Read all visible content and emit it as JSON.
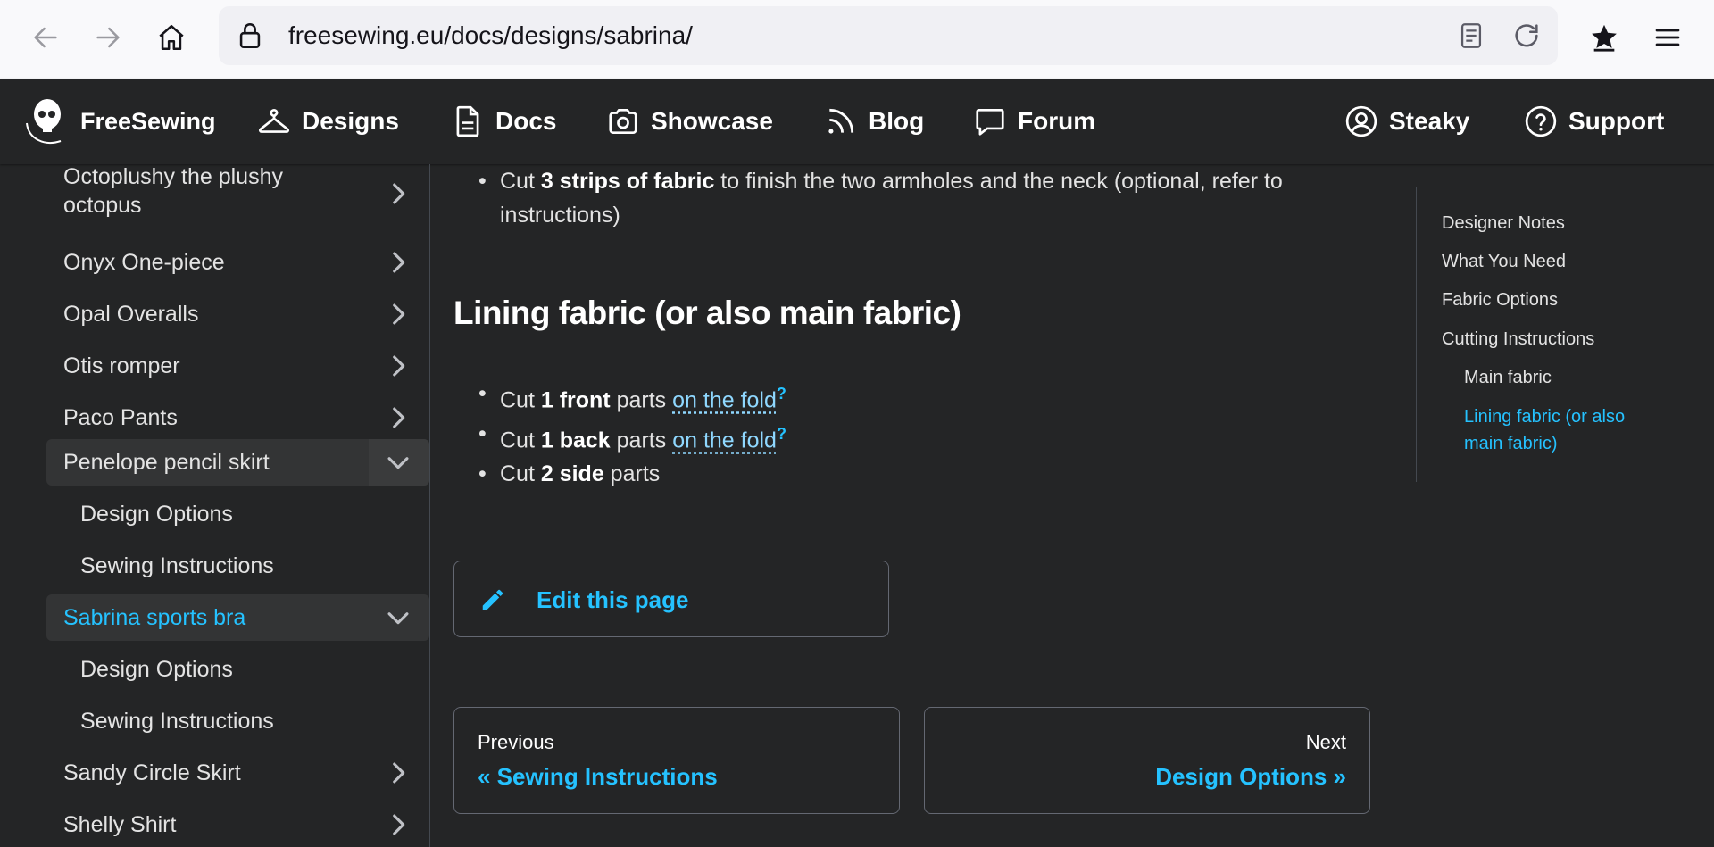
{
  "browser": {
    "url": "freesewing.eu/docs/designs/sabrina/"
  },
  "navbar": {
    "brand": "FreeSewing",
    "items": [
      {
        "label": "Designs",
        "icon": "hanger-icon"
      },
      {
        "label": "Docs",
        "icon": "document-icon"
      },
      {
        "label": "Showcase",
        "icon": "camera-icon"
      },
      {
        "label": "Blog",
        "icon": "rss-icon"
      },
      {
        "label": "Forum",
        "icon": "chat-icon"
      }
    ],
    "right": [
      {
        "label": "Steaky",
        "icon": "user-circle-icon"
      },
      {
        "label": "Support",
        "icon": "help-circle-icon"
      }
    ]
  },
  "sidebar": {
    "items": [
      {
        "label": "Octoplushy the plushy octopus",
        "line1": "Octoplushy the plushy",
        "line2": "octopus"
      },
      {
        "label": "Onyx One-piece"
      },
      {
        "label": "Opal Overalls"
      },
      {
        "label": "Otis romper"
      },
      {
        "label": "Paco Pants"
      },
      {
        "label": "Penelope pencil skirt"
      },
      {
        "label": "Sabrina sports bra"
      },
      {
        "label": "Sandy Circle Skirt"
      },
      {
        "label": "Shelly Shirt"
      }
    ],
    "penelope_sub": [
      "Design Options",
      "Sewing Instructions"
    ],
    "sabrina_sub": [
      "Design Options",
      "Sewing Instructions"
    ]
  },
  "content": {
    "top_bullet": {
      "pre": "Cut ",
      "bold": "3 strips of fabric",
      "post": " to finish the two armholes and the neck (optional, refer to",
      "post2": "instructions)"
    },
    "heading": "Lining fabric (or also main fabric)",
    "bullets": [
      {
        "pre": "Cut ",
        "bold": "1 front",
        "mid": " parts ",
        "link": "on the fold",
        "sup": "?"
      },
      {
        "pre": "Cut ",
        "bold": "1 back",
        "mid": " parts ",
        "link": "on the fold",
        "sup": "?"
      },
      {
        "pre": "Cut ",
        "bold": "2 side",
        "mid": " parts"
      }
    ],
    "edit_label": "Edit this page",
    "prev": {
      "sub": "Previous",
      "title": "« Sewing Instructions"
    },
    "next": {
      "sub": "Next",
      "title": "Design Options »"
    }
  },
  "toc": {
    "items": [
      "Designer Notes",
      "What You Need",
      "Fabric Options",
      "Cutting Instructions"
    ],
    "sub_items": [
      "Main fabric",
      "Lining fabric (or also",
      "main fabric)"
    ]
  },
  "colors": {
    "accent": "#25c2ff",
    "background": "#242526",
    "chrome": "#f9f9fb"
  }
}
